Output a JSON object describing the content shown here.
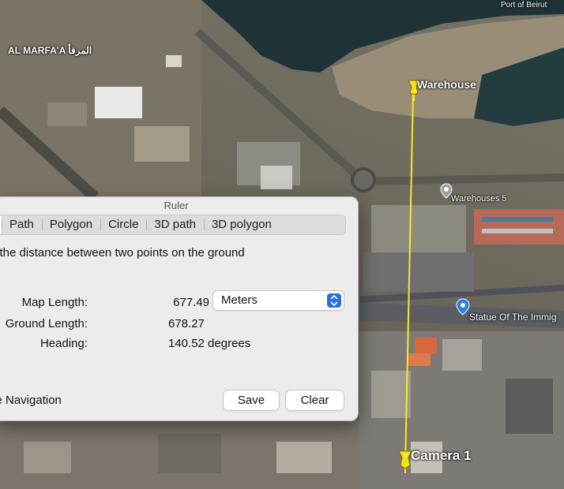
{
  "map": {
    "labels": {
      "port": "Port of Beirut",
      "district": "AL MARFA'A المرفأ",
      "warehouse": "Warehouse",
      "warehouses5": "Warehouses 5",
      "statue": "Statue Of The Immig",
      "camera": "Camera 1"
    },
    "ruler_line_color": "#f2ea2a",
    "pin_color": "#f4e41c"
  },
  "ruler": {
    "title": "Ruler",
    "tabs": [
      "Path",
      "Polygon",
      "Circle",
      "3D path",
      "3D polygon"
    ],
    "description": "e the distance between two points on the ground",
    "map_length_label": "Map Length:",
    "map_length_value": "677.49",
    "units_selected": "Meters",
    "ground_length_label": "Ground Length:",
    "ground_length_value": "678.27",
    "heading_label": "Heading:",
    "heading_value": "140.52 degrees",
    "navigation_label": "se Navigation",
    "save_label": "Save",
    "clear_label": "Clear",
    "accent_color": "#2a6fe0"
  }
}
